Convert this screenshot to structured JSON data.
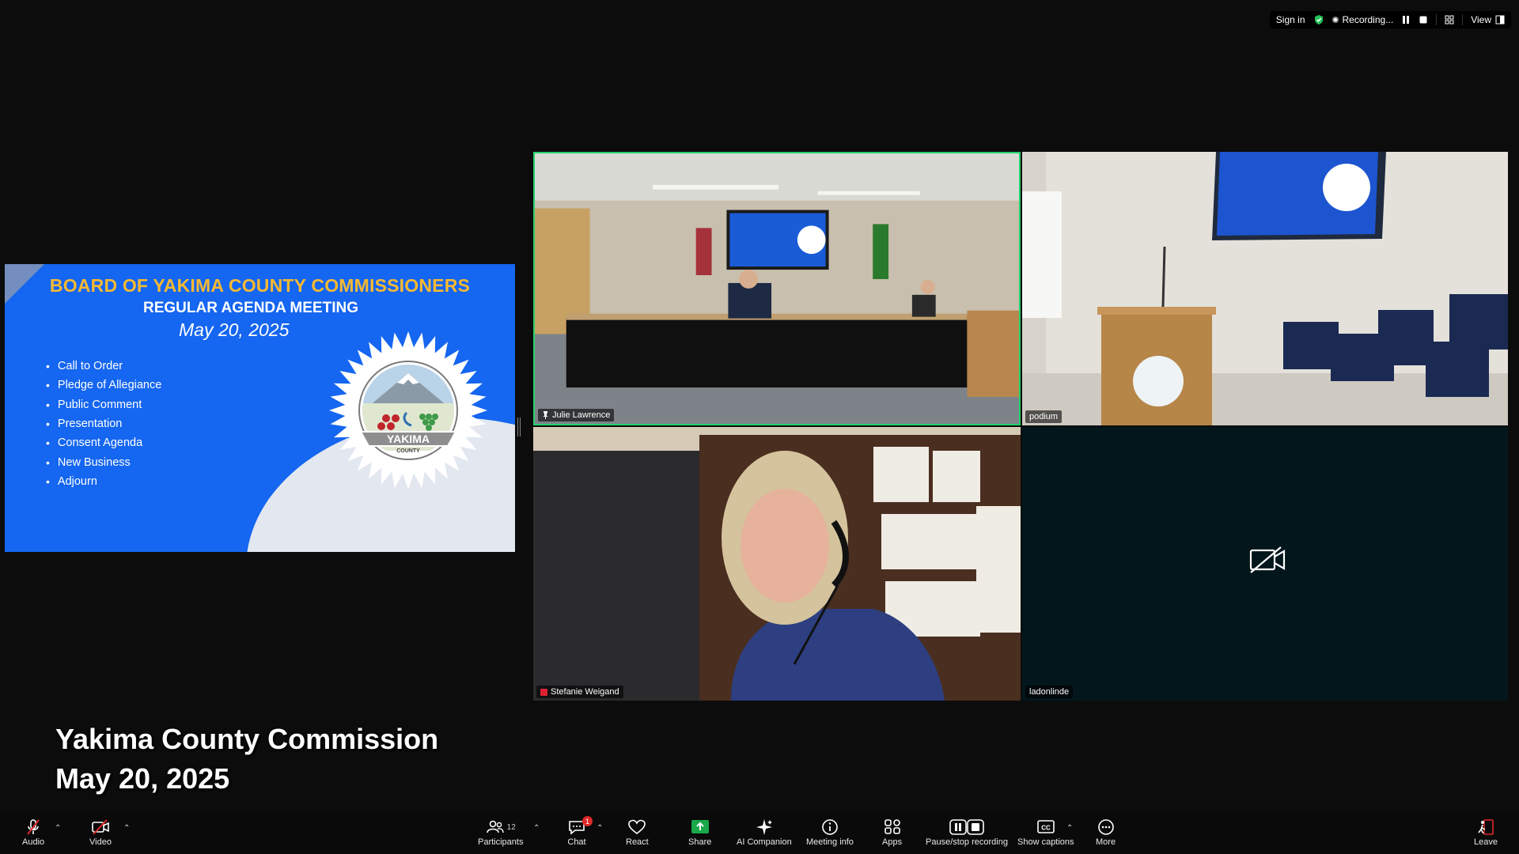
{
  "topbar": {
    "sign_in": "Sign in",
    "recording": "Recording...",
    "view": "View"
  },
  "slide": {
    "title": "BOARD OF YAKIMA COUNTY COMMISSIONERS",
    "subtitle": "REGULAR AGENDA MEETING",
    "date": "May 20, 2025",
    "agenda": [
      "Call to Order",
      "Pledge of Allegiance",
      "Public Comment",
      "Presentation",
      "Consent Agenda",
      "New Business",
      "Adjourn"
    ],
    "seal_text": "YAKIMA",
    "seal_sub": "COUNTY"
  },
  "tiles": [
    {
      "name": "Julie Lawrence",
      "pinned": true
    },
    {
      "name": "podium"
    },
    {
      "name": "Stefanie Weigand"
    },
    {
      "name": "ladonlinde",
      "video_off": true
    }
  ],
  "caption": {
    "line1": "Yakima County Commission",
    "line2": "May 20, 2025"
  },
  "toolbar": {
    "audio": "Audio",
    "video": "Video",
    "participants": "Participants",
    "participant_count": "12",
    "chat": "Chat",
    "chat_badge": "1",
    "react": "React",
    "share": "Share",
    "ai_companion": "AI Companion",
    "meeting_info": "Meeting info",
    "apps": "Apps",
    "pause_stop": "Pause/stop recording",
    "captions": "Show captions",
    "more": "More",
    "leave": "Leave"
  },
  "colors": {
    "active_speaker": "#21d36b",
    "slide_blue": "#1566f0",
    "slide_title": "#f6b932",
    "share_green": "#19a84a",
    "leave_red": "#e02828"
  }
}
